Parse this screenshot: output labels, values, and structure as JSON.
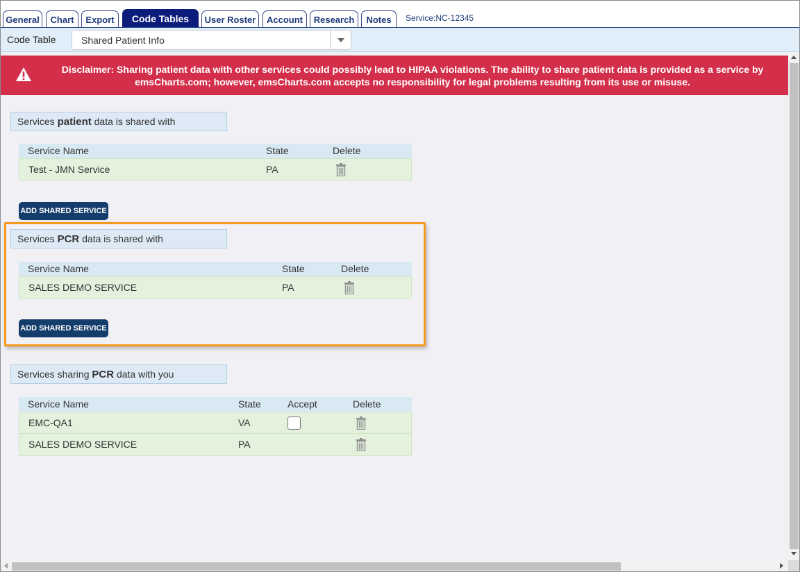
{
  "tabs": [
    {
      "label": "General"
    },
    {
      "label": "Chart"
    },
    {
      "label": "Export"
    },
    {
      "label": "Code Tables"
    },
    {
      "label": "User Roster"
    },
    {
      "label": "Account"
    },
    {
      "label": "Research"
    },
    {
      "label": "Notes"
    }
  ],
  "service_label": "Service:NC-12345",
  "code_table": {
    "label": "Code Table",
    "selected": "Shared Patient Info"
  },
  "disclaimer": {
    "line1": "Disclaimer: Sharing patient data with other services could possibly lead to HIPAA violations. The ability to share patient data is provided as a service by",
    "line2": "emsCharts.com; however, emsCharts.com accepts no responsibility for legal problems resulting from its use or misuse."
  },
  "patient_section": {
    "title_pre": "Services ",
    "title_bold": "patient",
    "title_post": " data is shared with",
    "headers": {
      "name": "Service Name",
      "state": "State",
      "delete": "Delete"
    },
    "rows": [
      {
        "name": "Test - JMN Service",
        "state": "PA"
      }
    ],
    "button": "ADD SHARED SERVICE"
  },
  "pcr_section": {
    "title_pre": "Services ",
    "title_bold": "PCR",
    "title_post": " data is shared with",
    "headers": {
      "name": "Service Name",
      "state": "State",
      "delete": "Delete"
    },
    "rows": [
      {
        "name": "SALES DEMO SERVICE",
        "state": "PA"
      }
    ],
    "button": "ADD SHARED SERVICE"
  },
  "sharing_section": {
    "title_pre": "Services sharing ",
    "title_bold": "PCR",
    "title_post": " data with you",
    "headers": {
      "name": "Service Name",
      "state": "State",
      "accept": "Accept",
      "delete": "Delete"
    },
    "rows": [
      {
        "name": "EMC-QA1",
        "state": "VA",
        "accept_checked": false
      },
      {
        "name": "SALES DEMO SERVICE",
        "state": "PA"
      }
    ]
  },
  "colors": {
    "active_tab": "#0b1c7a",
    "disclaimer_bg": "#d42f4a",
    "button_bg": "#143d6b",
    "highlight_border": "#f39a1e"
  }
}
